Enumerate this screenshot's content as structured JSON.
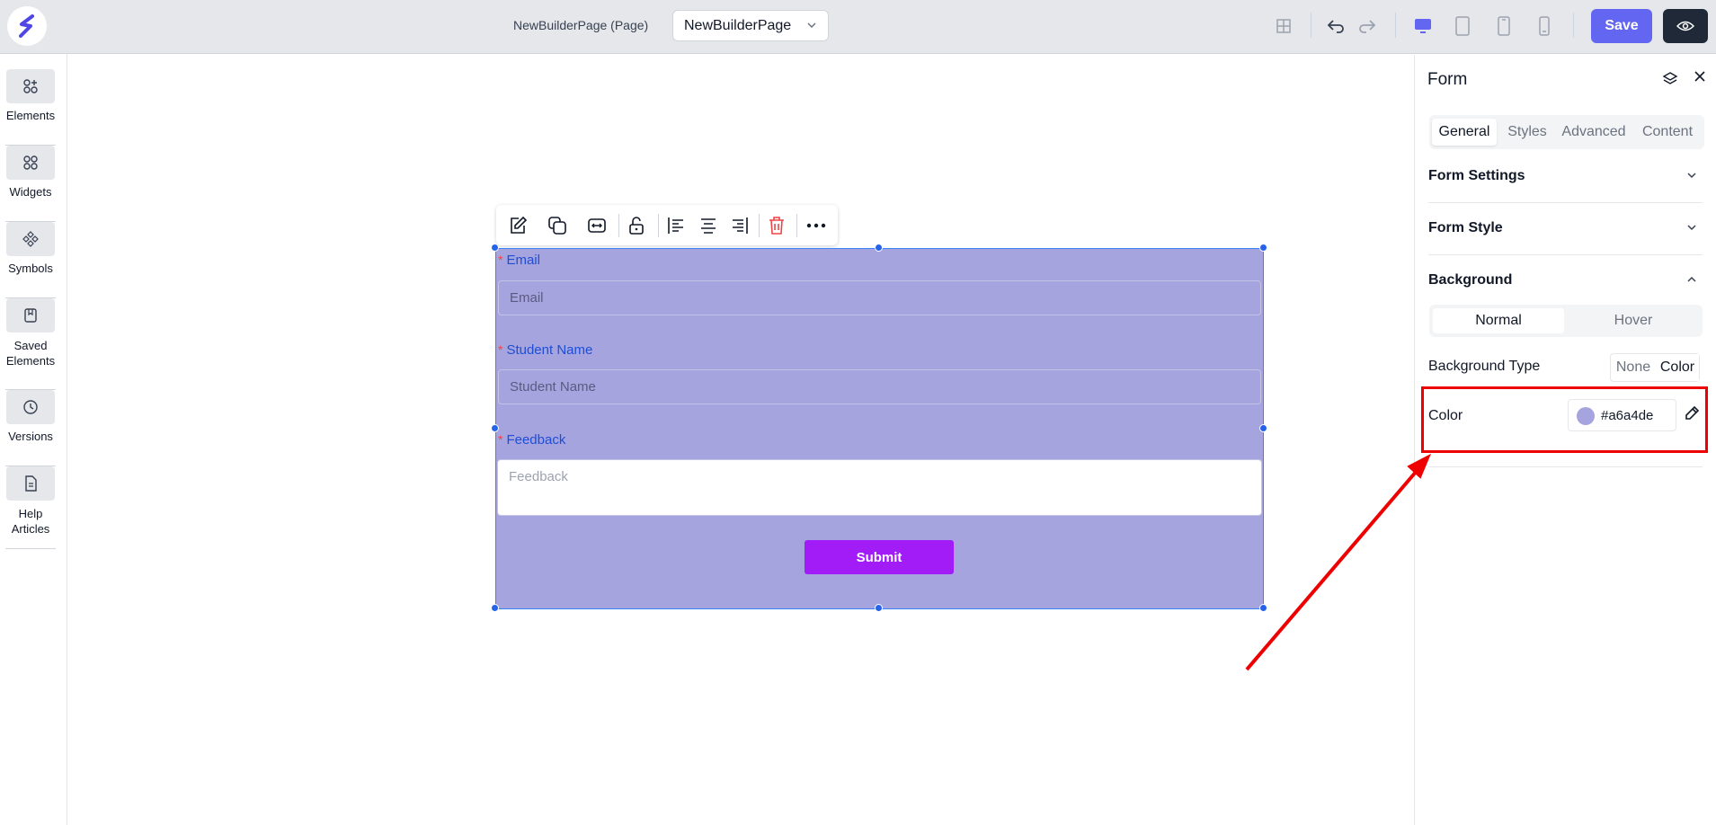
{
  "topbar": {
    "page_title": "NewBuilderPage (Page)",
    "page_select_value": "NewBuilderPage",
    "save_label": "Save"
  },
  "sidebar": {
    "items": [
      {
        "label": "Elements"
      },
      {
        "label": "Widgets"
      },
      {
        "label": "Symbols"
      },
      {
        "label": "Saved Elements"
      },
      {
        "label": "Versions"
      },
      {
        "label": "Help Articles"
      }
    ]
  },
  "form": {
    "background_color": "#a6a4de",
    "fields": [
      {
        "label": "Email",
        "placeholder": "Email"
      },
      {
        "label": "Student Name",
        "placeholder": "Student Name"
      },
      {
        "label": "Feedback",
        "placeholder": "Feedback"
      }
    ],
    "required_marker": "*",
    "submit_label": "Submit"
  },
  "panel": {
    "title": "Form",
    "tabs": [
      "General",
      "Styles",
      "Advanced",
      "Content"
    ],
    "active_tab": "General",
    "sections": {
      "form_settings": "Form Settings",
      "form_style": "Form Style",
      "background": "Background"
    },
    "state_options": [
      "Normal",
      "Hover"
    ],
    "active_state": "Normal",
    "background_type_label": "Background Type",
    "background_type_options": [
      "None",
      "Color"
    ],
    "background_type_selected": "Color",
    "color_label": "Color",
    "color_value": "#a6a4de"
  },
  "colors": {
    "accent": "#6366f1",
    "submit": "#a21cf7",
    "highlight": "#ef0000"
  }
}
